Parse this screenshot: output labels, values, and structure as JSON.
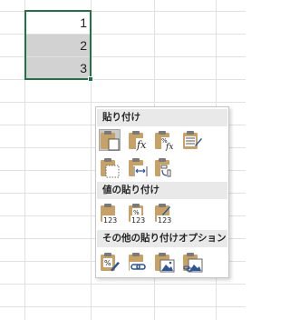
{
  "sheet": {
    "cells": [
      "1",
      "2",
      "3"
    ]
  },
  "paste_menu": {
    "sections": [
      {
        "title": "貼り付け",
        "icons": [
          "paste-icon",
          "paste-formulas-icon",
          "paste-formulas-number-formatting-icon",
          "keep-source-formatting-icon",
          "no-borders-icon",
          "keep-source-column-widths-icon",
          "transpose-icon"
        ]
      },
      {
        "title": "値の貼り付け",
        "icons": [
          "values-icon",
          "values-number-formatting-icon",
          "values-source-formatting-icon"
        ]
      },
      {
        "title": "その他の貼り付けオプション",
        "icons": [
          "formatting-icon",
          "paste-link-icon",
          "picture-icon",
          "linked-picture-icon"
        ]
      }
    ],
    "colors": {
      "clipboard": "#c8a264",
      "clip": "#7a7a7a",
      "accent_blue": "#2b579a",
      "selection_border": "#217346"
    }
  }
}
